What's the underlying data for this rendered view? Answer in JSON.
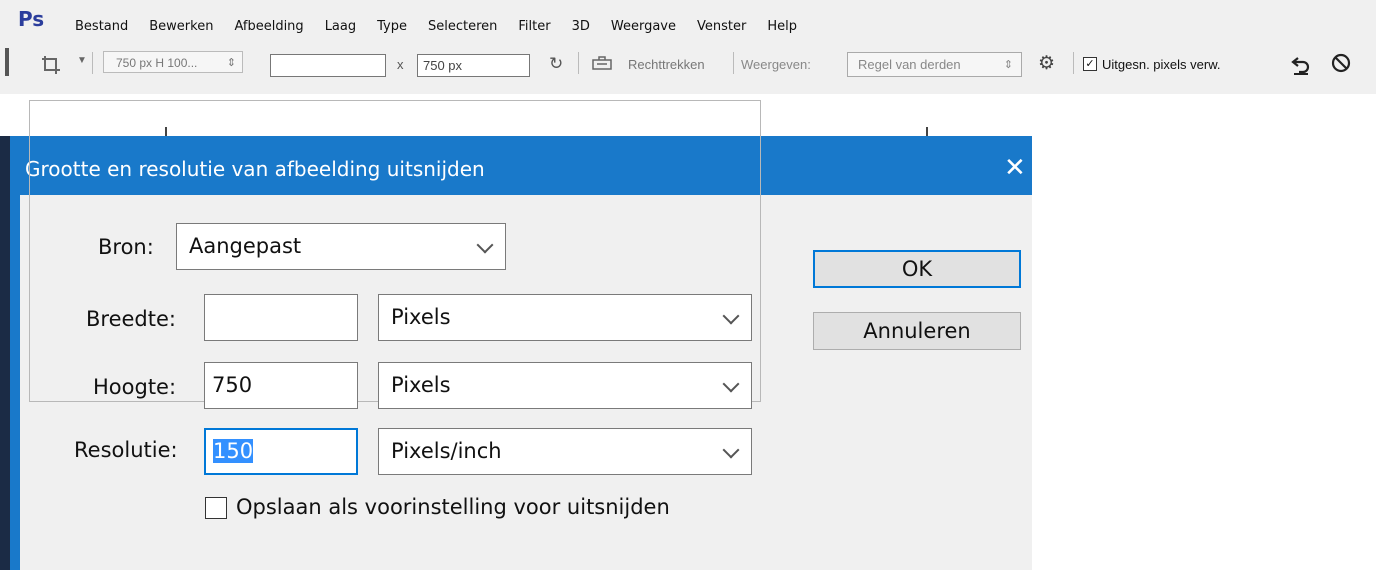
{
  "app": {
    "logo": "Ps",
    "menu": [
      "Bestand",
      "Bewerken",
      "Afbeelding",
      "Laag",
      "Type",
      "Selecteren",
      "Filter",
      "3D",
      "Weergave",
      "Venster",
      "Help"
    ]
  },
  "options_bar": {
    "preset_value": "750 px H 100...",
    "width_value": "",
    "times_sign": "x",
    "height_value": "750 px",
    "straighten_label": "Rechttrekken",
    "view_label": "Weergeven:",
    "overlay_value": "Regel van derden",
    "delete_cropped_checked": true,
    "delete_cropped_label": "Uitgesn. pixels verw."
  },
  "dialog": {
    "title": "Grootte en resolutie van afbeelding uitsnijden",
    "source_label": "Bron:",
    "source_value": "Aangepast",
    "width_label": "Breedte:",
    "width_value": "",
    "width_unit": "Pixels",
    "height_label": "Hoogte:",
    "height_value": "750",
    "height_unit": "Pixels",
    "resolution_label": "Resolutie:",
    "resolution_value": "150",
    "resolution_unit": "Pixels/inch",
    "save_preset_label": "Opslaan als voorinstelling voor uitsnijden",
    "save_preset_checked": false,
    "ok_label": "OK",
    "cancel_label": "Annuleren"
  },
  "colors": {
    "title_bar": "#1979ca",
    "focus": "#0078d7",
    "logo": "#2b3d9c"
  }
}
